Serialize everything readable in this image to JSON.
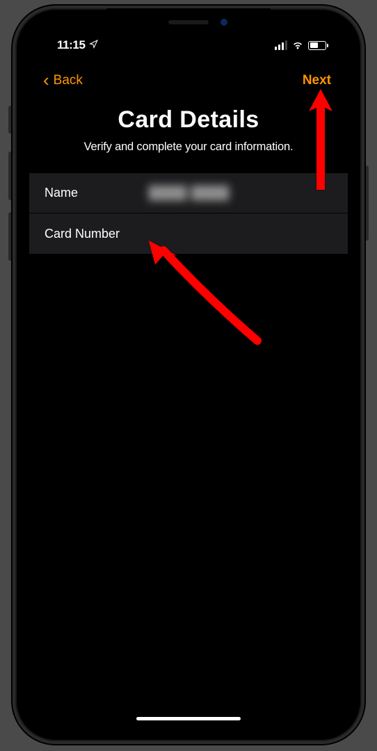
{
  "status_bar": {
    "time": "11:15"
  },
  "nav": {
    "back_label": "Back",
    "next_label": "Next"
  },
  "header": {
    "title": "Card Details",
    "subtitle": "Verify and complete your card information."
  },
  "form": {
    "name_label": "Name",
    "name_value": "████ ████",
    "card_number_label": "Card Number",
    "card_number_value": ""
  },
  "colors": {
    "accent": "#ff9500",
    "background": "#000000",
    "row_bg": "#1c1c1e",
    "arrow": "#ff0000"
  }
}
